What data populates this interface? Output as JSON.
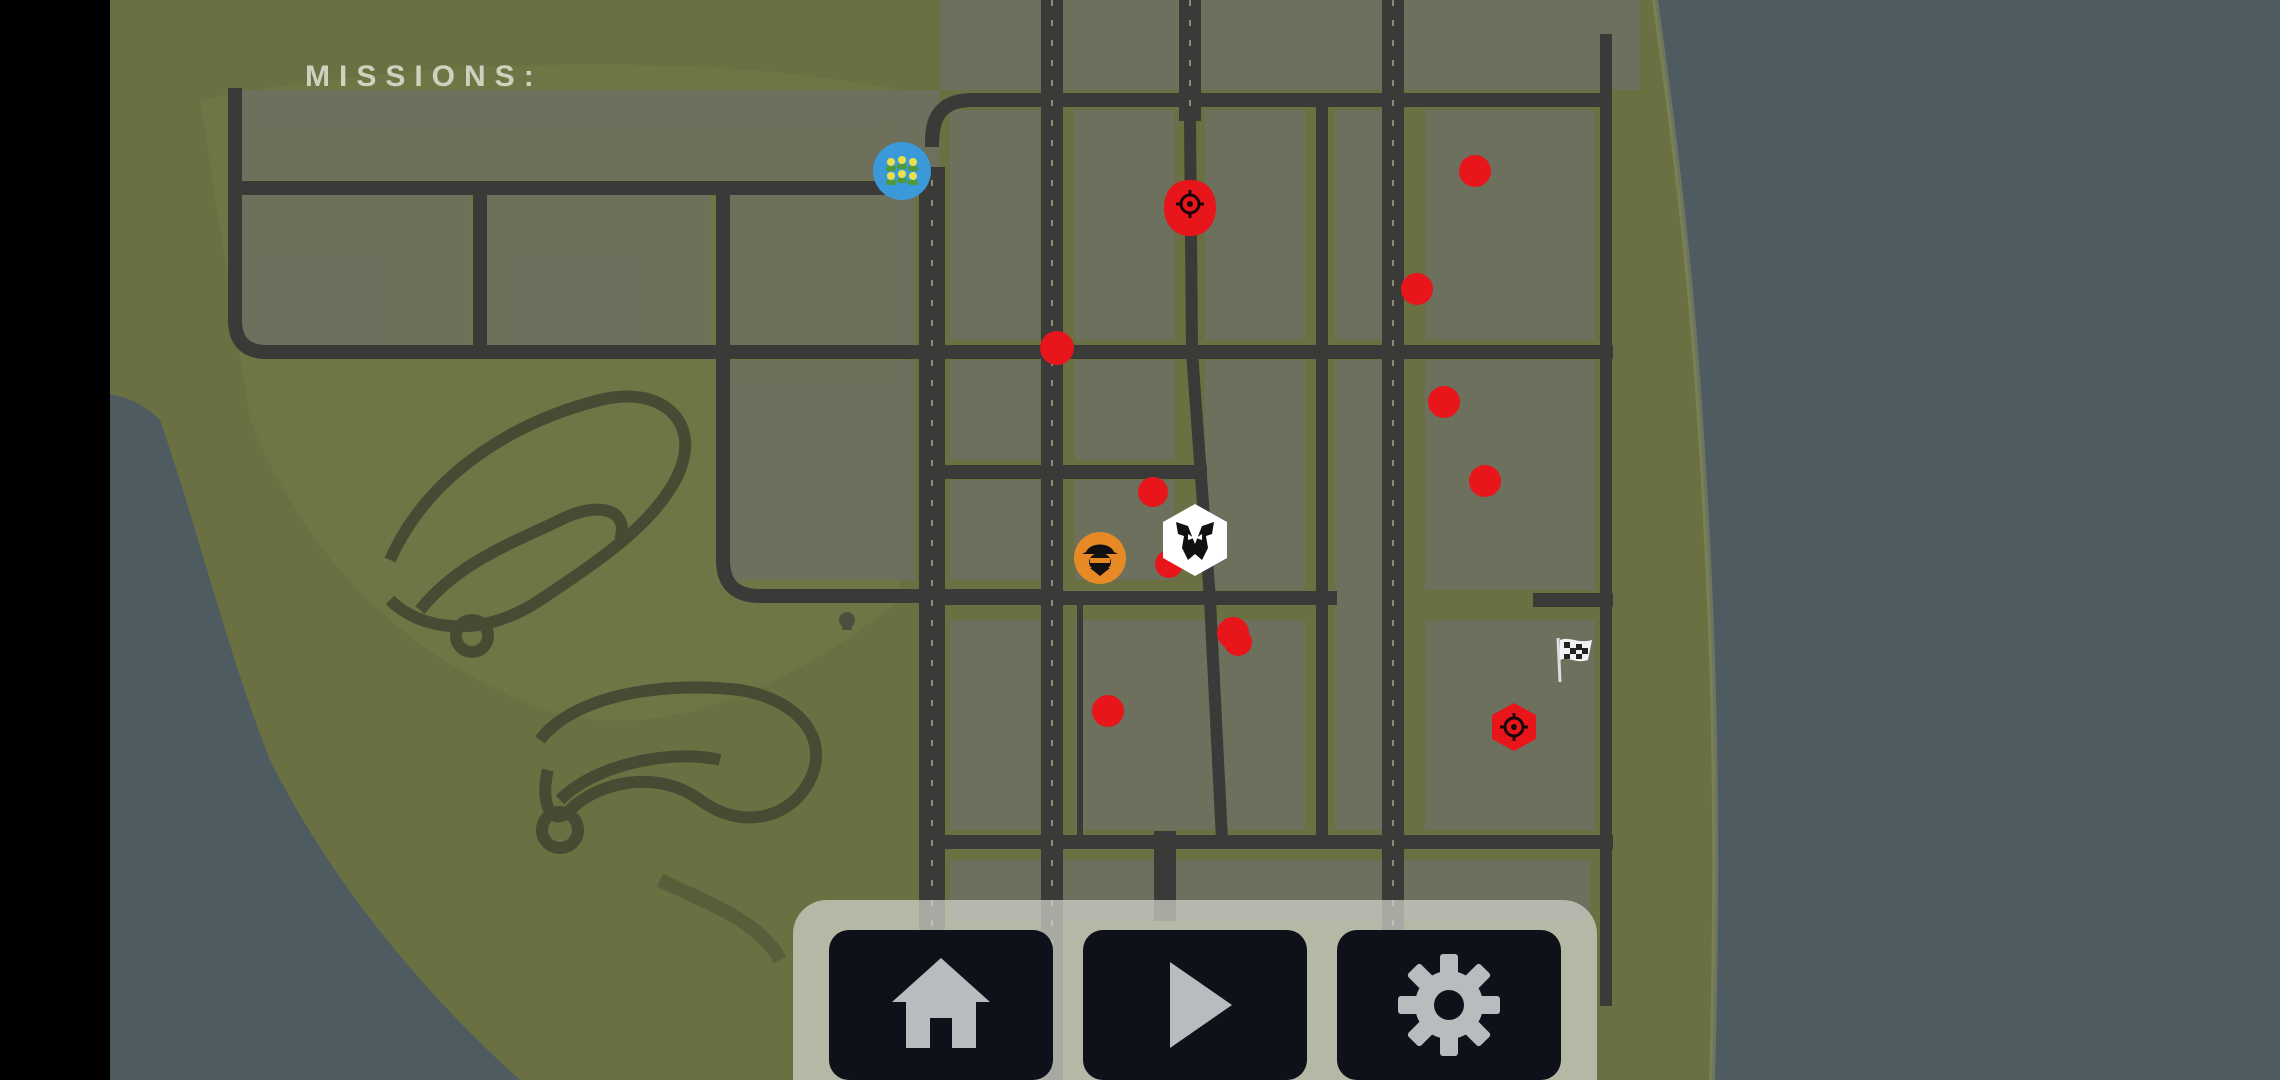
{
  "missions_label": "MISSIONS:",
  "colors": {
    "water": "#4e5b61",
    "land": "#6b7042",
    "road": "#3a3b38",
    "mission_red": "#e8151b",
    "toolbar_button": "#0e1119",
    "toolbar_icon": "#b9bcbe"
  },
  "markers": {
    "crowd": {
      "icon": "crowd-icon"
    },
    "target_primary": {
      "icon": "crosshair-icon"
    },
    "target_secondary": {
      "icon": "crosshair-icon"
    },
    "player": {
      "icon": "decepticon-icon"
    },
    "bandit": {
      "icon": "bandit-icon"
    },
    "finish": {
      "icon": "checkered-flag-icon"
    },
    "mission_dot_count": 11
  },
  "toolbar": {
    "home": {
      "icon": "home-icon"
    },
    "play": {
      "icon": "play-icon"
    },
    "settings": {
      "icon": "gear-icon"
    }
  }
}
